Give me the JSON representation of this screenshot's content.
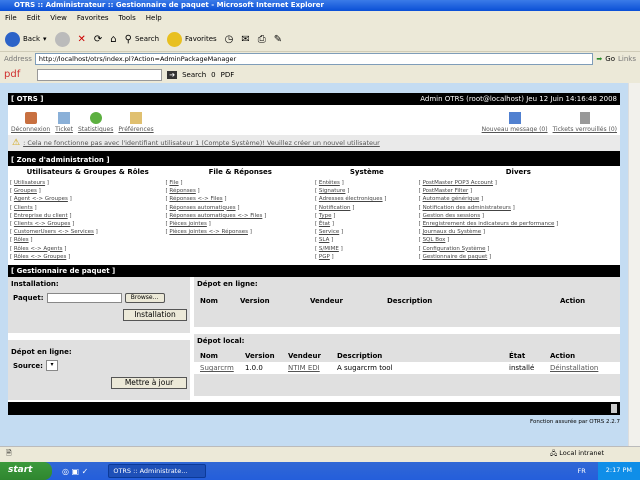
{
  "window": {
    "title": "OTRS :: Administrateur :: Gestionnaire de paquet - Microsoft Internet Explorer"
  },
  "menu": [
    "File",
    "Edit",
    "View",
    "Favorites",
    "Tools",
    "Help"
  ],
  "toolbar": {
    "back": "Back",
    "search": "Search",
    "favorites": "Favorites"
  },
  "address": {
    "label": "Address",
    "url": "http://localhost/otrs/index.pl?Action=AdminPackageManager",
    "go": "Go",
    "links": "Links"
  },
  "pdfbar": {
    "logo": "pdf",
    "search": "Search",
    "count": "0",
    "pdf": "PDF"
  },
  "otrs": {
    "brand": "[ OTRS ]",
    "user_info": "Admin OTRS (root@localhost) Jeu 12 Juin 14:16:48 2008",
    "nav": [
      "Déconnexion",
      "Ticket",
      "Statistiques",
      "Préférences"
    ],
    "nav_right": [
      "Nouveau message (0)",
      "Tickets verrouillés (0)"
    ],
    "warning": ": Cela ne fonctionne pas avec l'identifiant utilisateur 1 (Compte Système)! Veuillez créer un nouvel utilisateur",
    "admin_zone": "[ Zone d'administration ]",
    "columns": [
      {
        "title": "Utilisateurs & Groupes & Rôles",
        "items": [
          "Utilisateurs",
          "Groupes",
          "Agent <-> Groupes",
          "Clients",
          "Entreprise du client",
          "Clients <-> Groupes",
          "CustomerUsers <-> Services",
          "Rôles",
          "Rôles <-> Agents",
          "Rôles <-> Groupes"
        ]
      },
      {
        "title": "File & Réponses",
        "items": [
          "File",
          "Réponses",
          "Réponses <-> Files",
          "Réponses automatiques",
          "Réponses automatiques <-> Files",
          "Pièces jointes",
          "Pièces jointes <-> Réponses"
        ]
      },
      {
        "title": "Système",
        "items": [
          "Entêtes",
          "Signature",
          "Adresses électroniques",
          "Notification",
          "Type",
          "État",
          "Service",
          "SLA",
          "S/MIME",
          "PGP"
        ]
      },
      {
        "title": "Divers",
        "items": [
          "PostMaster POP3 Account",
          "PostMaster Filter",
          "Automate générique",
          "Notification des administrateurs",
          "Gestion des sessions",
          "Enregistrement des indicateurs de performance",
          "Journaux du Système",
          "SQL Box",
          "Configuration Système",
          "Gestionnaire de paquet"
        ]
      }
    ],
    "package_manager": "[ Gestionnaire de paquet ]",
    "install": {
      "title": "Installation:",
      "label": "Paquet:",
      "value": "",
      "browse": "Browse...",
      "button": "Installation"
    },
    "online_left": {
      "title": "Dépot en ligne:",
      "label": "Source:",
      "value": "",
      "button": "Mettre à jour"
    },
    "online_repo": {
      "title": "Dépot en ligne:",
      "headers": [
        "Nom",
        "Version",
        "Vendeur",
        "Description",
        "Action"
      ]
    },
    "local_repo": {
      "title": "Dépot local:",
      "headers": [
        "Nom",
        "Version",
        "Vendeur",
        "Description",
        "État",
        "Action"
      ],
      "rows": [
        {
          "name": "Sugarcrm",
          "version": "1.0.0",
          "vendor": "NTIM EDI",
          "description": "A sugarcrm tool",
          "state": "installé",
          "action": "Déinstallation"
        }
      ]
    },
    "footer": "Fonction assurée par OTRS 2.2.7"
  },
  "status": {
    "zone": "Local intranet"
  },
  "taskbar": {
    "start": "start",
    "task": "OTRS :: Administrate...",
    "lang": "FR",
    "time": "2:17 PM"
  }
}
